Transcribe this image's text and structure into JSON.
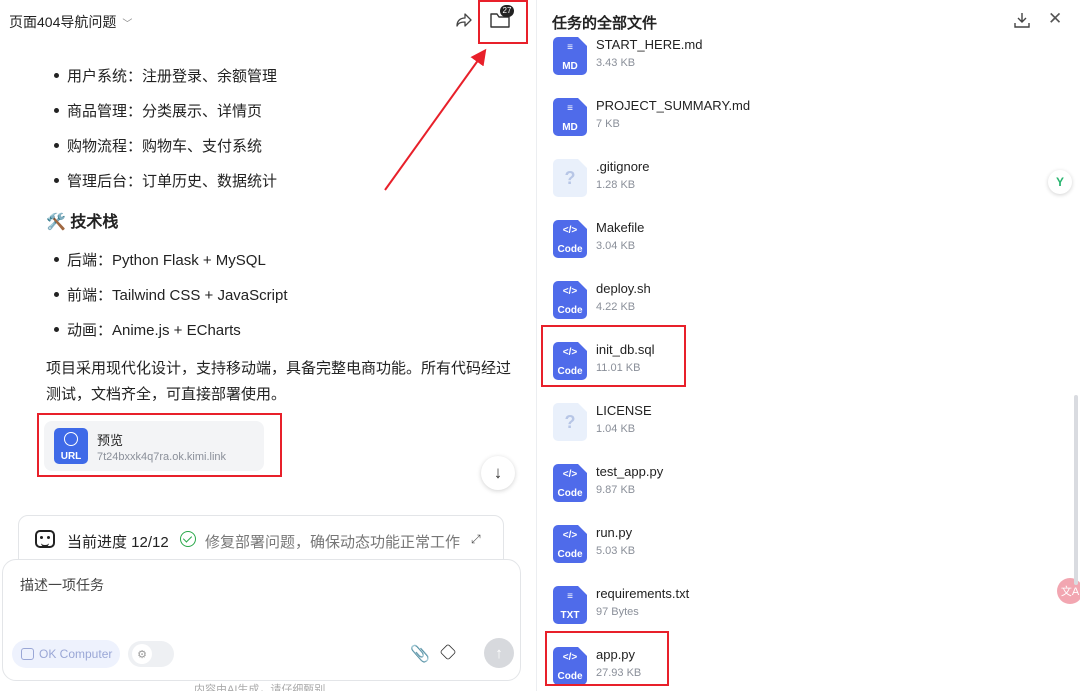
{
  "chat": {
    "title": "页面404导航问题",
    "files_badge": "27",
    "features": [
      "用户系统：注册登录、余额管理",
      "商品管理：分类展示、详情页",
      "购物流程：购物车、支付系统",
      "管理后台：订单历史、数据统计"
    ],
    "tech_heading": "🛠️ 技术栈",
    "tech_items": [
      "后端：Python Flask + MySQL",
      "前端：Tailwind CSS + JavaScript",
      "动画：Anime.js + ECharts"
    ],
    "summary": "项目采用现代化设计，支持移动端，具备完整电商功能。所有代码经过测试，文档齐全，可直接部署使用。",
    "link_card": {
      "name": "预览",
      "url": "7t24bxxk4q7ra.ok.kimi.link",
      "tag": "URL"
    },
    "progress": {
      "label": "当前进度 12/12",
      "step": "修复部署问题，确保动态功能正常工作"
    },
    "input_placeholder": "描述一项任务",
    "ok_computer_label": "OK Computer",
    "footer_note": "内容由AI生成，请仔细甄别"
  },
  "files_panel": {
    "title": "任务的全部文件",
    "files": [
      {
        "name": "START_HERE.md",
        "size": "3.43 KB",
        "kind": "md",
        "tag": "MD"
      },
      {
        "name": "PROJECT_SUMMARY.md",
        "size": "7 KB",
        "kind": "md",
        "tag": "MD"
      },
      {
        "name": ".gitignore",
        "size": "1.28 KB",
        "kind": "unk",
        "tag": ""
      },
      {
        "name": "Makefile",
        "size": "3.04 KB",
        "kind": "code",
        "tag": "Code"
      },
      {
        "name": "deploy.sh",
        "size": "4.22 KB",
        "kind": "code",
        "tag": "Code"
      },
      {
        "name": "init_db.sql",
        "size": "11.01 KB",
        "kind": "code",
        "tag": "Code"
      },
      {
        "name": "LICENSE",
        "size": "1.04 KB",
        "kind": "unk",
        "tag": ""
      },
      {
        "name": "test_app.py",
        "size": "9.87 KB",
        "kind": "code",
        "tag": "Code"
      },
      {
        "name": "run.py",
        "size": "5.03 KB",
        "kind": "code",
        "tag": "Code"
      },
      {
        "name": "requirements.txt",
        "size": "97 Bytes",
        "kind": "txt",
        "tag": "TXT"
      },
      {
        "name": "app.py",
        "size": "27.93 KB",
        "kind": "code",
        "tag": "Code"
      }
    ]
  },
  "colors": {
    "accent": "#4f6bea",
    "highlight_red": "#e8202a",
    "success": "#2aa84a"
  }
}
